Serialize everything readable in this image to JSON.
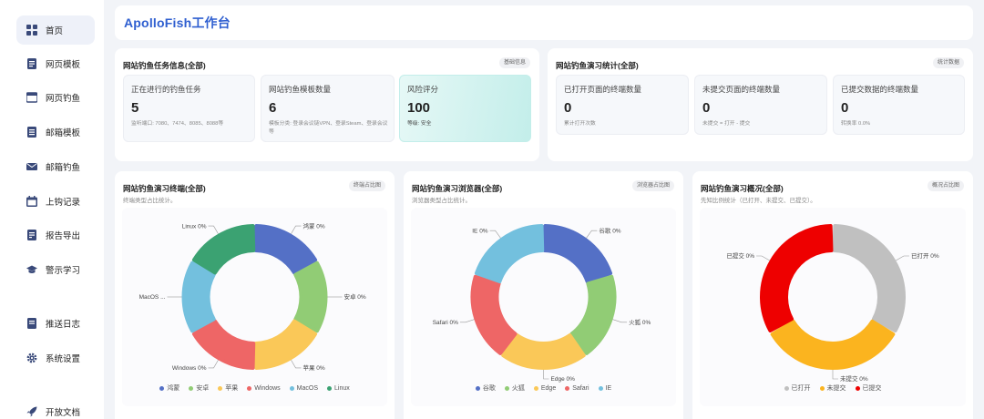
{
  "brand": "ApolloFish工作台",
  "sidebar": {
    "items": [
      {
        "label": "首页",
        "icon": "dashboard-icon",
        "active": true
      },
      {
        "label": "网页模板",
        "icon": "template-icon"
      },
      {
        "label": "网页钓鱼",
        "icon": "browser-icon"
      },
      {
        "label": "邮箱模板",
        "icon": "mail-template-icon"
      },
      {
        "label": "邮箱钓鱼",
        "icon": "mail-icon"
      },
      {
        "label": "上钩记录",
        "icon": "calendar-icon"
      },
      {
        "label": "报告导出",
        "icon": "report-icon"
      },
      {
        "label": "警示学习",
        "icon": "graduation-cap-icon"
      },
      {
        "label": "推送日志",
        "icon": "log-icon"
      },
      {
        "label": "系统设置",
        "icon": "gear-icon"
      },
      {
        "label": "开放文档",
        "icon": "rocket-icon"
      }
    ]
  },
  "task_card": {
    "title": "网站钓鱼任务信息(全部)",
    "tag": "基础信息",
    "stats": [
      {
        "label": "正在进行的钓鱼任务",
        "value": "5",
        "desc": "监听端口: 7080、7474、8085、8088等"
      },
      {
        "label": "网站钓鱼模板数量",
        "value": "6",
        "desc": "模板分类: 登录会议链VPN、登录Steam、登录会议等"
      },
      {
        "label": "风险评分",
        "value": "100",
        "desc": "等级: 安全"
      }
    ]
  },
  "drill_card": {
    "title": "网站钓鱼演习统计(全部)",
    "tag": "统计数据",
    "stats": [
      {
        "label": "已打开页面的终端数量",
        "value": "0",
        "desc": "累计打开次数"
      },
      {
        "label": "未提交页面的终端数量",
        "value": "0",
        "desc": "未提交 = 打开 - 提交"
      },
      {
        "label": "已提交数据的终端数量",
        "value": "0",
        "desc": "转换率 0.0%"
      }
    ]
  },
  "chart_data": [
    {
      "type": "pie",
      "title": "网站钓鱼演习终端(全部)",
      "tag": "终端占比图",
      "subtitle": "终端类型占比统计。",
      "categories": [
        "鸿蒙",
        "安卓",
        "苹果",
        "Windows",
        "MacOS",
        "Linux"
      ],
      "values": [
        0,
        0,
        0,
        0,
        0,
        0
      ],
      "slice_labels": [
        "鸿蒙 0%",
        "安卓 0%",
        "苹果 0%",
        "Windows 0%",
        "MacOS ...",
        "Linux 0%"
      ],
      "colors": [
        "#5470c6",
        "#91cc75",
        "#fac858",
        "#ee6666",
        "#73c0de",
        "#3ba272"
      ],
      "legend_position": "bottom"
    },
    {
      "type": "pie",
      "title": "网站钓鱼演习浏览器(全部)",
      "tag": "浏览器占比图",
      "subtitle": "浏览器类型占比统计。",
      "categories": [
        "谷歌",
        "火狐",
        "Edge",
        "Safari",
        "IE"
      ],
      "values": [
        0,
        0,
        0,
        0,
        0
      ],
      "slice_labels": [
        "谷歌 0%",
        "火狐 0%",
        "Edge 0%",
        "Safari 0%",
        "IE 0%"
      ],
      "colors": [
        "#5470c6",
        "#91cc75",
        "#fac858",
        "#ee6666",
        "#73c0de"
      ],
      "legend_position": "bottom"
    },
    {
      "type": "pie",
      "title": "网站钓鱼演习概况(全部)",
      "tag": "概况占比图",
      "subtitle": "先知比例统计（已打开、未提交、已提交）。",
      "categories": [
        "已打开",
        "未提交",
        "已提交"
      ],
      "values": [
        0,
        0,
        0
      ],
      "slice_labels": [
        "已打开 0%",
        "未提交 0%",
        "已提交 0%"
      ],
      "colors": [
        "#c0c0c0",
        "#fbb41f",
        "#ee0000"
      ],
      "legend_position": "bottom"
    }
  ]
}
